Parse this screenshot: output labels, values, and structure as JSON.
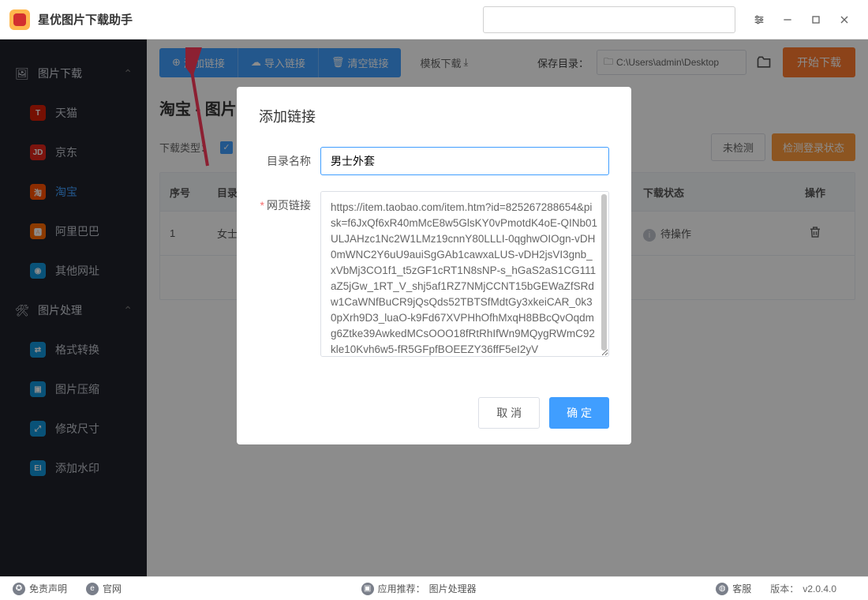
{
  "app": {
    "title": "星优图片下载助手"
  },
  "sidebar": {
    "group1": {
      "label": "图片下载"
    },
    "items1": [
      {
        "label": "天猫",
        "color": "#d81e06",
        "badge": "T"
      },
      {
        "label": "京东",
        "color": "#e1251b",
        "badge": "JD"
      },
      {
        "label": "淘宝",
        "color": "#ff5000",
        "badge": "淘"
      },
      {
        "label": "阿里巴巴",
        "color": "#ff6a00",
        "badge": "🅰"
      },
      {
        "label": "其他网址",
        "color": "#1296db",
        "badge": "◉"
      }
    ],
    "group2": {
      "label": "图片处理"
    },
    "items2": [
      {
        "label": "格式转换",
        "color": "#1296db",
        "badge": "⇄"
      },
      {
        "label": "图片压缩",
        "color": "#1296db",
        "badge": "▣"
      },
      {
        "label": "修改尺寸",
        "color": "#1296db",
        "badge": "⤢"
      },
      {
        "label": "添加水印",
        "color": "#1296db",
        "badge": "EI"
      }
    ]
  },
  "toolbar": {
    "add": "添加链接",
    "import": "导入链接",
    "clear": "清空链接",
    "template": "模板下载",
    "save_dir_label": "保存目录：",
    "save_dir": "C:\\Users\\admin\\Desktop",
    "start": "开始下载"
  },
  "page": {
    "title": "淘宝 - 图片下",
    "filter_label": "下载类型：",
    "btn_undetected": "未检测",
    "btn_detect": "检测登录状态"
  },
  "table": {
    "headers": {
      "idx": "序号",
      "dir": "目录名",
      "link": "",
      "status": "下载状态",
      "op": "操作"
    },
    "rows": [
      {
        "idx": "1",
        "dir": "女士",
        "status": "待操作"
      }
    ]
  },
  "modal": {
    "title": "添加链接",
    "dir_label": "目录名称",
    "dir_value": "男士外套",
    "link_label": "网页链接",
    "link_value": "https://item.taobao.com/item.htm?id=825267288654&pisk=f6JxQf6xR40mMcE8w5GlsKY0vPmotdK4oE-QINb01ULJAHzc1Nc2W1LMz19cnnY80LLLI-0qghwOIOgn-vDH0mWNC2Y6uU9auiSgGAb1cawxaLUS-vDH2jsVI3gnb_xVbMj3CO1f1_t5zGF1cRT1N8sNP-s_hGaS2aS1CG111aZ5jGw_1RT_V_shj5af1RZ7NMjCCNT15bGEWaZfSRdw1CaWNfBuCR9jQsQds52TBTSfMdtGy3xkeiCAR_0k30pXrh9D3_luaO-k9Fd67XVPHhOfhMxqH8BBcQvOqdmg6Ztke39AwkedMCsOOO18fRtRhIfWn9MQygRWmC92kle10Kvh6w5-fR5GFpfBOEEZY36ffF5eI2yV",
    "cancel": "取 消",
    "ok": "确 定"
  },
  "statusbar": {
    "disclaimer": "免责声明",
    "site": "官网",
    "recommend_label": "应用推荐：",
    "recommend": "图片处理器",
    "service": "客服",
    "version_label": "版本：",
    "version": "v2.0.4.0"
  },
  "colors": {
    "primary": "#409eff",
    "accent": "#ff7b2e"
  }
}
